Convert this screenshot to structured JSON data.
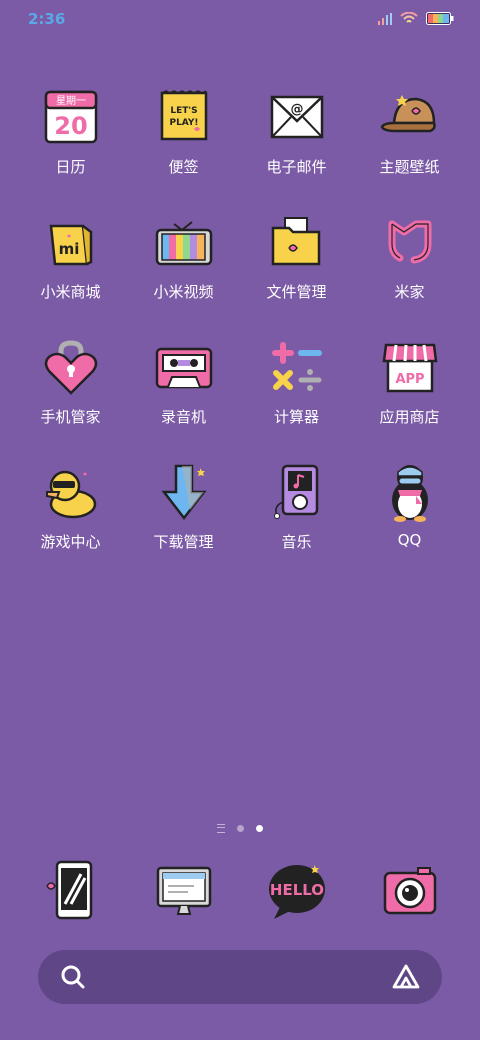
{
  "status_bar": {
    "time": "2:36"
  },
  "grid": [
    [
      {
        "name": "calendar",
        "label": "日历",
        "icon_text": "星期一",
        "icon_num": "20"
      },
      {
        "name": "notes",
        "label": "便签",
        "icon_text": "LET'S PLAY!"
      },
      {
        "name": "email",
        "label": "电子邮件",
        "icon_text": "@"
      },
      {
        "name": "themes",
        "label": "主题壁纸"
      }
    ],
    [
      {
        "name": "mi-store",
        "label": "小米商城",
        "icon_text": "mi"
      },
      {
        "name": "mi-video",
        "label": "小米视频"
      },
      {
        "name": "file-manager",
        "label": "文件管理"
      },
      {
        "name": "mi-home",
        "label": "米家"
      }
    ],
    [
      {
        "name": "security",
        "label": "手机管家"
      },
      {
        "name": "recorder",
        "label": "录音机"
      },
      {
        "name": "calculator",
        "label": "计算器"
      },
      {
        "name": "app-store",
        "label": "应用商店",
        "icon_text": "APP"
      }
    ],
    [
      {
        "name": "game-center",
        "label": "游戏中心"
      },
      {
        "name": "downloads",
        "label": "下载管理"
      },
      {
        "name": "music",
        "label": "音乐"
      },
      {
        "name": "qq",
        "label": "QQ"
      }
    ]
  ],
  "dock": [
    {
      "name": "phone"
    },
    {
      "name": "browser"
    },
    {
      "name": "messages",
      "icon_text": "HELLO"
    },
    {
      "name": "camera"
    }
  ],
  "pager": {
    "pages": 2,
    "current": 2
  },
  "colors": {
    "background": "#7b5aa6",
    "search_bar": "#5f4787",
    "time": "#5aa9e6"
  }
}
